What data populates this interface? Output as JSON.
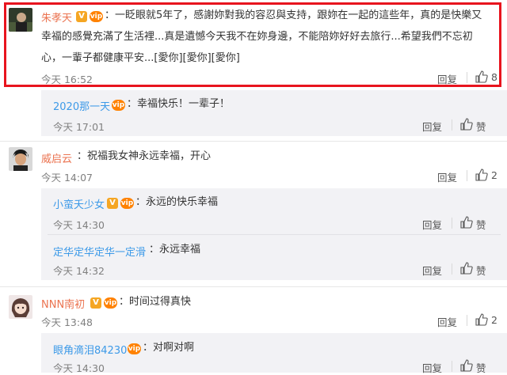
{
  "comments": [
    {
      "username": "朱孝天",
      "text_lines": [
        "：一眨眼就5年了，感謝妳對我的容忍與支持，跟妳在一起的這些年，真的是快樂又",
        "幸福的感覺充滿了生活裡...真是遺憾今天我不在妳身邊，不能陪妳好好去旅行...希望我們不忘初",
        "心，一輩子都健康平安...[愛你][愛你][愛你]"
      ],
      "time": "今天 16:52",
      "reply_label": "回复",
      "like_count": "8",
      "replies": [
        {
          "username": "2020那一天",
          "text": "：幸福快乐！一辈子！",
          "time": "今天 17:01",
          "reply_label": "回复",
          "like_label": "赞"
        }
      ]
    },
    {
      "username": "威启云",
      "text": "：祝福我女神永远幸福，开心",
      "time": "今天 14:07",
      "reply_label": "回复",
      "like_count": "2",
      "replies": [
        {
          "username": "小蛮夭少女",
          "text": "：永远的快乐幸福",
          "time": "今天 14:30",
          "reply_label": "回复",
          "like_label": "赞"
        },
        {
          "username": "定华定华定华一定滑",
          "text": "：永远幸福",
          "time": "今天 14:32",
          "reply_label": "回复",
          "like_label": "赞"
        }
      ]
    },
    {
      "username": "NNN南初",
      "text": "：时间过得真快",
      "time": "今天 13:48",
      "reply_label": "回复",
      "like_count": "2",
      "replies": [
        {
          "username": "眼角滴泪84230",
          "text": "：对啊对啊",
          "time": "今天 14:30",
          "reply_label": "回复",
          "like_label": "赞"
        }
      ]
    }
  ],
  "badges": {
    "verified": "V",
    "vip": "vip"
  },
  "colors": {
    "highlight": "#e8141e",
    "name_orange": "#eb7350",
    "name_blue": "#3d9ae8",
    "reply_bg": "#f2f2f5"
  }
}
